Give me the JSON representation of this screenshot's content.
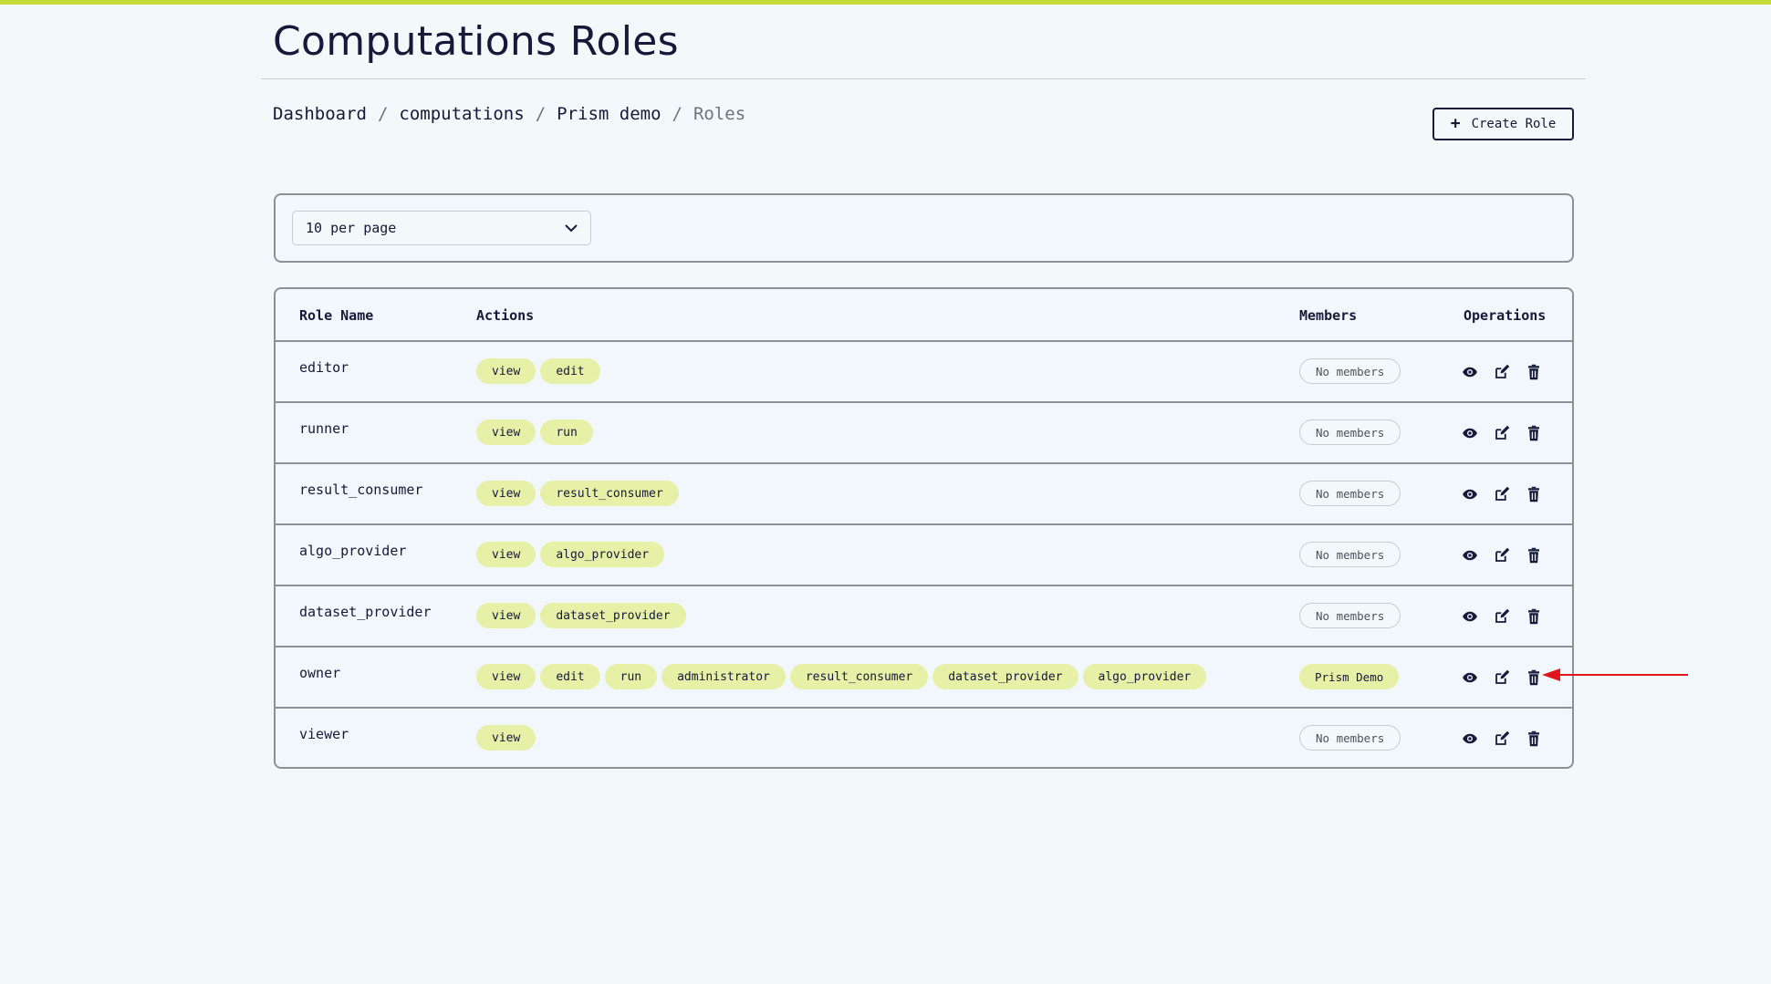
{
  "header": {
    "title": "Computations Roles",
    "create_button": "Create Role"
  },
  "breadcrumb": [
    {
      "label": "Dashboard"
    },
    {
      "label": "computations"
    },
    {
      "label": "Prism demo"
    },
    {
      "label": "Roles"
    }
  ],
  "pagination": {
    "per_page": "10 per page"
  },
  "table": {
    "headers": {
      "name": "Role Name",
      "actions": "Actions",
      "members": "Members",
      "operations": "Operations"
    },
    "rows": [
      {
        "name": "editor",
        "actions": [
          "view",
          "edit"
        ],
        "members": "No members",
        "has_members": false
      },
      {
        "name": "runner",
        "actions": [
          "view",
          "run"
        ],
        "members": "No members",
        "has_members": false
      },
      {
        "name": "result_consumer",
        "actions": [
          "view",
          "result_consumer"
        ],
        "members": "No members",
        "has_members": false
      },
      {
        "name": "algo_provider",
        "actions": [
          "view",
          "algo_provider"
        ],
        "members": "No members",
        "has_members": false
      },
      {
        "name": "dataset_provider",
        "actions": [
          "view",
          "dataset_provider"
        ],
        "members": "No members",
        "has_members": false
      },
      {
        "name": "owner",
        "actions": [
          "view",
          "edit",
          "run",
          "administrator",
          "result_consumer",
          "dataset_provider",
          "algo_provider"
        ],
        "members": "Prism Demo",
        "has_members": true
      },
      {
        "name": "viewer",
        "actions": [
          "view"
        ],
        "members": "No members",
        "has_members": false
      }
    ]
  },
  "icons": {
    "view": "eye-icon",
    "edit": "edit-icon",
    "delete": "trash-icon"
  },
  "colors": {
    "accent": "#c5dc3a",
    "pill": "#e6f0a6",
    "text": "#16193a",
    "annotation": "#e0161c"
  }
}
